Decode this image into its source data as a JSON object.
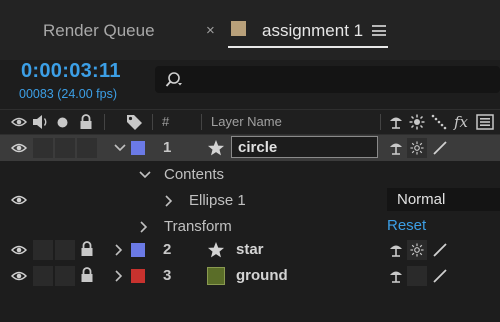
{
  "tabs": {
    "render_queue": "Render Queue",
    "close_glyph": "×",
    "active_label": "assignment 1",
    "active_swatch_color": "#b8a07a"
  },
  "time": {
    "timecode": "0:00:03:11",
    "frames": "00083 (24.00 fps)"
  },
  "search": {
    "placeholder": ""
  },
  "columns": {
    "number_label": "#",
    "layer_name_label": "Layer Name"
  },
  "layers": [
    {
      "number": "1",
      "name": "circle",
      "label_color": "#6b7ae6",
      "selected": true,
      "renaming": true,
      "type_icon": "star-icon"
    },
    {
      "number": "2",
      "name": "star",
      "label_color": "#6b7ae6",
      "selected": false,
      "locked": true,
      "type_icon": "star-icon"
    },
    {
      "number": "3",
      "name": "ground",
      "label_color": "#c8322e",
      "selected": false,
      "locked": true,
      "type_icon": "solid-swatch",
      "solid_color": "#5a6d28"
    }
  ],
  "contents": {
    "label": "Contents",
    "ellipse_label": "Ellipse 1",
    "blend_mode": "Normal",
    "transform_label": "Transform",
    "reset_label": "Reset"
  }
}
